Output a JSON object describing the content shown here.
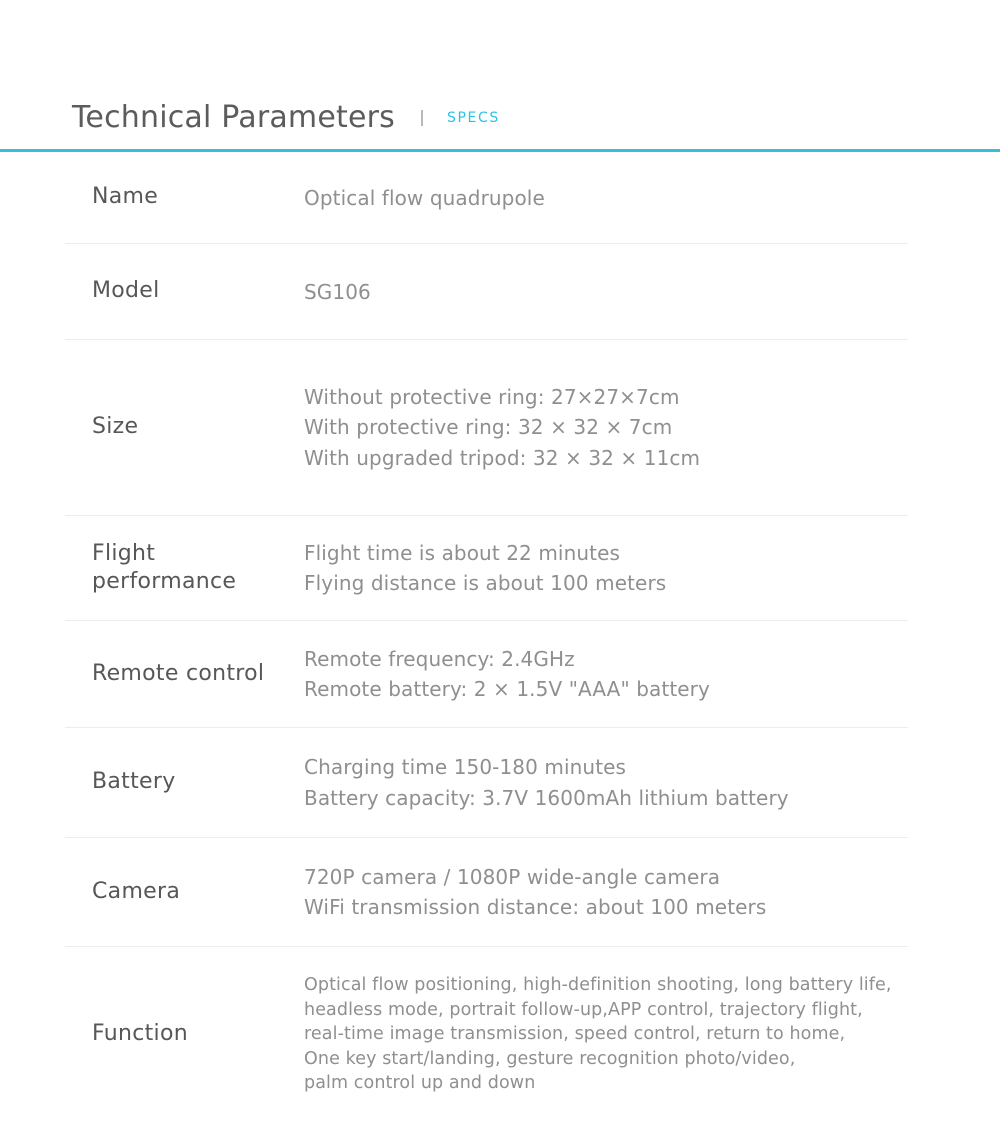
{
  "header": {
    "title": "Technical Parameters",
    "separator": "|",
    "tag": "SPECS",
    "accent_color": "#36bedd",
    "tag_color": "#2ec3e4"
  },
  "spec_table": {
    "label_color": "#575757",
    "value_color": "#8f8f8f",
    "divider_color": "#ececec",
    "rows": [
      {
        "label": "Name",
        "lines": [
          "Optical flow quadrupole"
        ]
      },
      {
        "label": "Model",
        "lines": [
          "SG106"
        ]
      },
      {
        "label": "Size",
        "lines": [
          "Without protective ring: 27×27×7cm",
          "With protective ring: 32 × 32 × 7cm",
          "With upgraded tripod: 32 × 32 × 11cm"
        ]
      },
      {
        "label": "Flight performance",
        "lines": [
          "Flight time is about 22 minutes",
          "Flying distance is about 100 meters"
        ]
      },
      {
        "label": "Remote control",
        "lines": [
          "Remote frequency: 2.4GHz",
          "Remote battery: 2 × 1.5V \"AAA\" battery"
        ]
      },
      {
        "label": "Battery",
        "lines": [
          "Charging time 150-180 minutes",
          "Battery capacity: 3.7V 1600mAh lithium battery"
        ]
      },
      {
        "label": "Camera",
        "lines": [
          "720P camera / 1080P wide-angle camera",
          "WiFi transmission distance: about 100 meters"
        ]
      },
      {
        "label": "Function",
        "lines": [
          "Optical flow positioning, high-definition shooting, long battery life,",
          "headless mode, portrait follow-up,APP control, trajectory flight,",
          "real-time image transmission, speed control, return to home,",
          "One key start/landing, gesture recognition photo/video,",
          "palm control up and down"
        ]
      }
    ]
  }
}
